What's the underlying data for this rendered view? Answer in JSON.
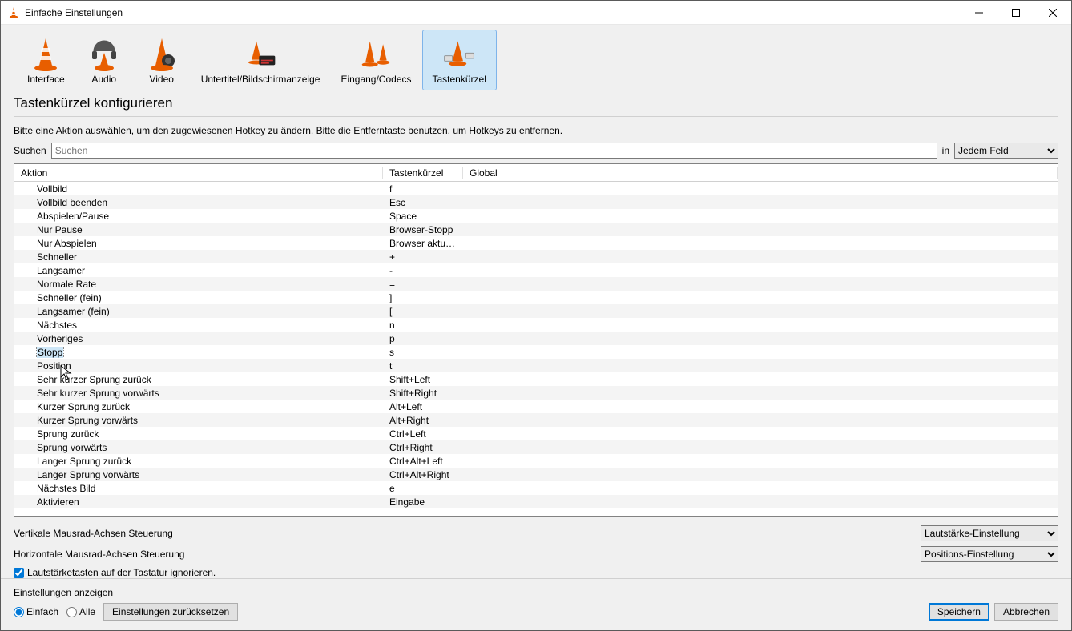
{
  "window": {
    "title": "Einfache Einstellungen"
  },
  "tabs": [
    {
      "label": "Interface"
    },
    {
      "label": "Audio"
    },
    {
      "label": "Video"
    },
    {
      "label": "Untertitel/Bildschirmanzeige"
    },
    {
      "label": "Eingang/Codecs"
    },
    {
      "label": "Tastenkürzel"
    }
  ],
  "section": {
    "title": "Tastenkürzel konfigurieren"
  },
  "hint": "Bitte eine Aktion auswählen, um den zugewiesenen Hotkey zu ändern. Bitte die Entferntaste benutzen, um Hotkeys zu entfernen.",
  "search": {
    "label": "Suchen",
    "placeholder": "Suchen",
    "in": "in",
    "scope": "Jedem Feld"
  },
  "columns": {
    "action": "Aktion",
    "hotkey": "Tastenkürzel",
    "global": "Global"
  },
  "rows": [
    {
      "action": "Vollbild",
      "hotkey": "f",
      "global": ""
    },
    {
      "action": "Vollbild beenden",
      "hotkey": "Esc",
      "global": ""
    },
    {
      "action": "Abspielen/Pause",
      "hotkey": "Space",
      "global": ""
    },
    {
      "action": "Nur Pause",
      "hotkey": "Browser-Stopp",
      "global": ""
    },
    {
      "action": "Nur Abspielen",
      "hotkey": "Browser aktuali...",
      "global": ""
    },
    {
      "action": "Schneller",
      "hotkey": "+",
      "global": ""
    },
    {
      "action": "Langsamer",
      "hotkey": "-",
      "global": ""
    },
    {
      "action": "Normale Rate",
      "hotkey": "=",
      "global": ""
    },
    {
      "action": "Schneller (fein)",
      "hotkey": "]",
      "global": ""
    },
    {
      "action": "Langsamer (fein)",
      "hotkey": "[",
      "global": ""
    },
    {
      "action": "Nächstes",
      "hotkey": "n",
      "global": ""
    },
    {
      "action": "Vorheriges",
      "hotkey": "p",
      "global": ""
    },
    {
      "action": "Stopp",
      "hotkey": "s",
      "global": "",
      "selected": true
    },
    {
      "action": "Position",
      "hotkey": "t",
      "global": ""
    },
    {
      "action": "Sehr kurzer Sprung zurück",
      "hotkey": "Shift+Left",
      "global": ""
    },
    {
      "action": "Sehr kurzer Sprung vorwärts",
      "hotkey": "Shift+Right",
      "global": ""
    },
    {
      "action": "Kurzer Sprung zurück",
      "hotkey": "Alt+Left",
      "global": ""
    },
    {
      "action": "Kurzer Sprung vorwärts",
      "hotkey": "Alt+Right",
      "global": ""
    },
    {
      "action": "Sprung zurück",
      "hotkey": "Ctrl+Left",
      "global": ""
    },
    {
      "action": "Sprung vorwärts",
      "hotkey": "Ctrl+Right",
      "global": ""
    },
    {
      "action": "Langer Sprung zurück",
      "hotkey": "Ctrl+Alt+Left",
      "global": ""
    },
    {
      "action": "Langer Sprung vorwärts",
      "hotkey": "Ctrl+Alt+Right",
      "global": ""
    },
    {
      "action": "Nächstes Bild",
      "hotkey": "e",
      "global": ""
    },
    {
      "action": "Aktivieren",
      "hotkey": "Eingabe",
      "global": ""
    }
  ],
  "wheel": {
    "vLabel": "Vertikale Mausrad-Achsen Steuerung",
    "vValue": "Lautstärke-Einstellung",
    "hLabel": "Horizontale Mausrad-Achsen Steuerung",
    "hValue": "Positions-Einstellung",
    "ignore": "Lautstärketasten auf der Tastatur ignorieren."
  },
  "footer": {
    "showSettings": "Einstellungen anzeigen",
    "simple": "Einfach",
    "all": "Alle",
    "reset": "Einstellungen zurücksetzen",
    "save": "Speichern",
    "cancel": "Abbrechen"
  }
}
